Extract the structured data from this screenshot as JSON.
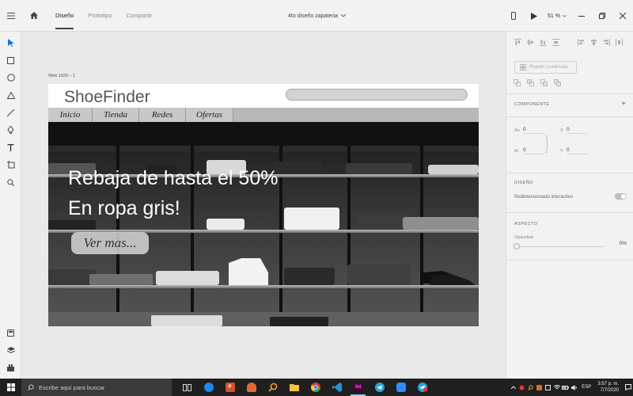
{
  "titlebar": {
    "tabs": [
      {
        "label": "Diseño",
        "active": true
      },
      {
        "label": "Prototipo",
        "active": false
      },
      {
        "label": "Compartir",
        "active": false
      }
    ],
    "document_name": "4to diseño zapateria",
    "zoom": "51 %"
  },
  "artboard": {
    "label": "Web 1920 – 1",
    "logo": "ShoeFinder",
    "nav": [
      "Inicio",
      "Tienda",
      "Redes",
      "Ofertas"
    ],
    "hero_line1": "Rebaja de hasta el 50%",
    "hero_line2": "En ropa gris!",
    "hero_button": "Ver mas..."
  },
  "right_panel": {
    "repeat_grid": "Repetir cuadrícula",
    "component_title": "COMPONENTE",
    "width_label": "An",
    "width_value": "0",
    "x_label": "X",
    "x_value": "0",
    "height_label": "Al",
    "height_value": "0",
    "y_label": "Y",
    "y_value": "0",
    "design_title": "DISEÑO",
    "responsive_resize": "Redimensionado interactivo",
    "appearance_title": "ASPECTO",
    "opacity_label": "Opacidad",
    "opacity_value": "0%"
  },
  "taskbar": {
    "search_placeholder": "Escribe aquí para buscar",
    "language": "ESP",
    "time": "3:57 p. m.",
    "date": "7/7/2020"
  },
  "colors": {
    "accent": "#2680eb",
    "taskbar_bg": "#1f1f1f",
    "xd_brand": "#470137"
  }
}
